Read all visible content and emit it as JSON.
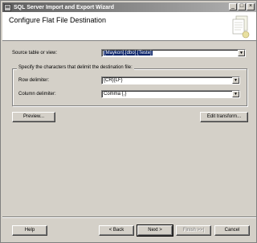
{
  "window": {
    "title": "SQL Server Import and Export Wizard",
    "minimize_glyph": "_",
    "maximize_glyph": "□",
    "close_glyph": "×"
  },
  "header": {
    "page_title": "Configure Flat File Destination",
    "art_icon": "flat-file-wizard-graphic"
  },
  "source": {
    "label": "Source table or view:",
    "value": "[Maykon].[dbo].[Teste]"
  },
  "group": {
    "label": "Specify the characters that delimit the destination file:",
    "row_label": "Row delimiter:",
    "row_value": "{CR}{LF}",
    "column_label": "Column delimiter:",
    "column_value": "Comma {,}"
  },
  "buttons": {
    "preview": "Preview...",
    "edit_transform": "Edit transform...",
    "help": "Help",
    "back": "< Back",
    "next": "Next >",
    "finish": "Finish >>|",
    "cancel": "Cancel"
  },
  "colors": {
    "selection": "#0a246a",
    "face": "#d4d0c8"
  }
}
